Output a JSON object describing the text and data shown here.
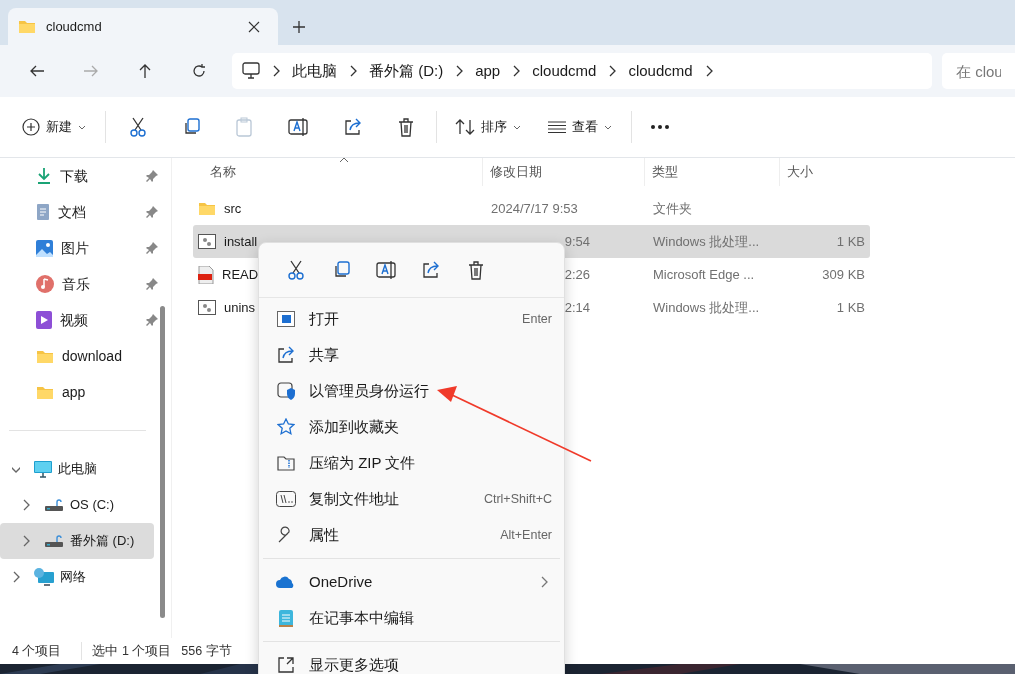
{
  "tabs": [
    {
      "label": "cloudcmd",
      "selected": true
    }
  ],
  "address": {
    "crumbs": [
      "此电脑",
      "番外篇 (D:)",
      "app",
      "cloudcmd",
      "cloudcmd"
    ]
  },
  "search": {
    "placeholder": "在 clou"
  },
  "toolbar": {
    "new_label": "新建",
    "paste_disabled": true,
    "sort_label": "排序",
    "view_label": "查看"
  },
  "sidebar": {
    "quick_access": [
      {
        "label": "下载",
        "kind": "download",
        "pinned": true
      },
      {
        "label": "文档",
        "kind": "documents",
        "pinned": true
      },
      {
        "label": "图片",
        "kind": "pictures",
        "pinned": true
      },
      {
        "label": "音乐",
        "kind": "music",
        "pinned": true
      },
      {
        "label": "视频",
        "kind": "videos",
        "pinned": true
      },
      {
        "label": "download",
        "kind": "folder",
        "pinned": false
      },
      {
        "label": "app",
        "kind": "folder",
        "pinned": false
      }
    ],
    "tree": [
      {
        "label": "此电脑",
        "kind": "pc",
        "expanded": true,
        "selected": false,
        "children": [
          {
            "label": "OS (C:)",
            "kind": "drive",
            "expanded": false,
            "selected": false
          },
          {
            "label": "番外篇 (D:)",
            "kind": "drive",
            "expanded": false,
            "selected": true
          }
        ]
      },
      {
        "label": "网络",
        "kind": "network",
        "expanded": false,
        "selected": false
      }
    ]
  },
  "table": {
    "columns": [
      {
        "label": "名称",
        "sorted": true
      },
      {
        "label": "修改日期",
        "sorted": false
      },
      {
        "label": "类型",
        "sorted": false
      },
      {
        "label": "大小",
        "sorted": false
      }
    ],
    "rows": [
      {
        "name": "src",
        "kind": "folder",
        "modified": "2024/7/17 9:53",
        "type": "文件夹",
        "selected": false
      },
      {
        "name": "install",
        "kind": "batch",
        "modified": "9:54",
        "type": "Windows 批处理...",
        "size": "1 KB",
        "selected": true
      },
      {
        "name": "READ",
        "kind": "pdf",
        "modified": "2:26",
        "type": "Microsoft Edge ...",
        "size": "309 KB",
        "selected": false
      },
      {
        "name": "unins",
        "kind": "batch",
        "modified": "2:14",
        "type": "Windows 批处理...",
        "size": "1 KB",
        "selected": false
      }
    ]
  },
  "context_menu": {
    "quick_actions": [
      {
        "kind": "cut"
      },
      {
        "kind": "copy"
      },
      {
        "kind": "rename"
      },
      {
        "kind": "share"
      },
      {
        "kind": "delete"
      }
    ],
    "items": [
      {
        "kind": "open",
        "label": "打开",
        "shortcut": "Enter"
      },
      {
        "kind": "share",
        "label": "共享"
      },
      {
        "kind": "admin",
        "label": "以管理员身份运行"
      },
      {
        "kind": "favorite",
        "label": "添加到收藏夹"
      },
      {
        "kind": "zip",
        "label": "压缩为 ZIP 文件"
      },
      {
        "kind": "path",
        "label": "复制文件地址",
        "shortcut": "Ctrl+Shift+C"
      },
      {
        "kind": "properties",
        "label": "属性",
        "shortcut": "Alt+Enter"
      },
      {
        "kind": "separator"
      },
      {
        "kind": "onedrive",
        "label": "OneDrive",
        "submenu": true
      },
      {
        "kind": "notepad",
        "label": "在记事本中编辑"
      },
      {
        "kind": "separator"
      },
      {
        "kind": "more",
        "label": "显示更多选项"
      }
    ]
  },
  "annotation": {
    "arrow": true
  },
  "status_bar": {
    "count": "4 个项目",
    "selection": "选中 1 个项目",
    "size": "556 字节"
  }
}
